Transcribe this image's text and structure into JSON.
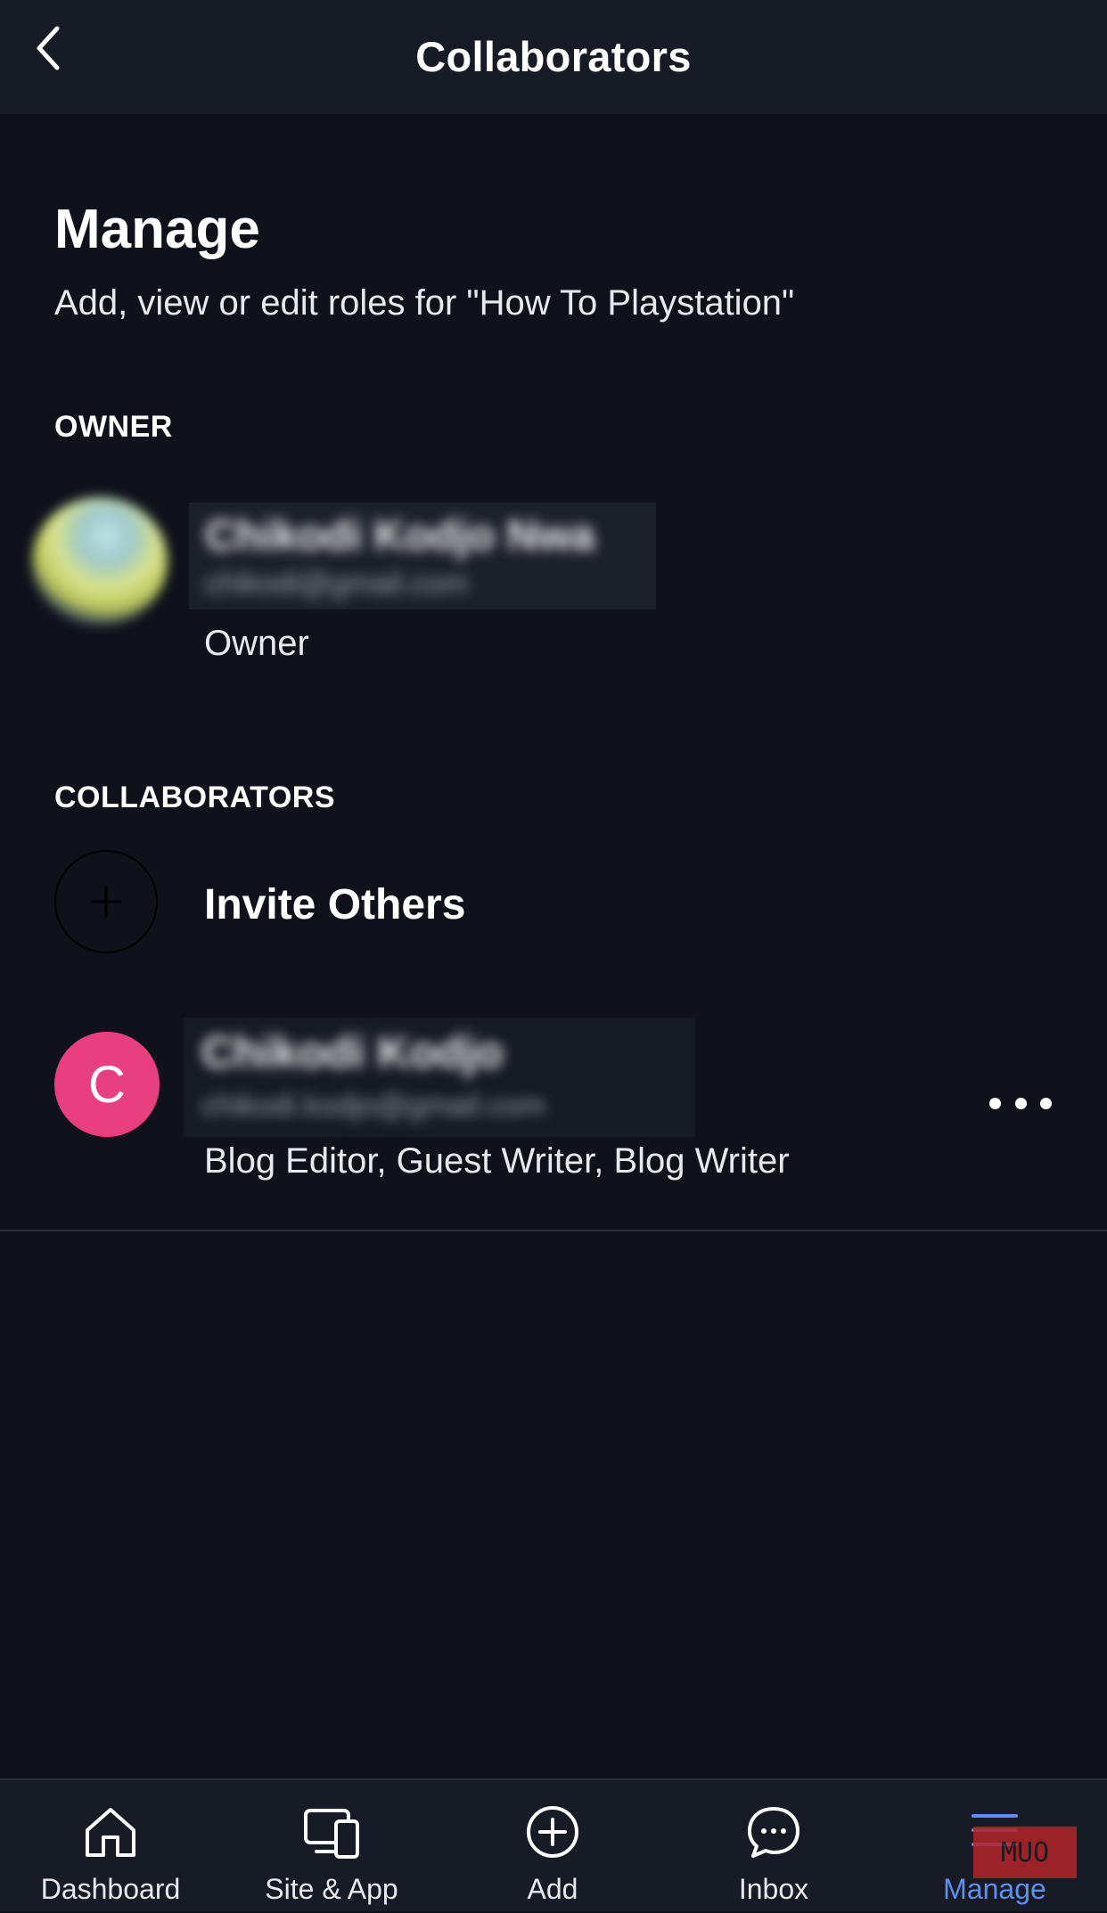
{
  "header": {
    "title": "Collaborators",
    "back_icon": "chevron-left-icon"
  },
  "manage": {
    "title": "Manage",
    "subtitle": "Add, view or edit roles for \"How To Playstation\""
  },
  "owner_section": {
    "label": "OWNER",
    "owner": {
      "name": "Chikodi Kodjo Nwa",
      "email": "chikodi@gmail.com",
      "role": "Owner"
    }
  },
  "collaborators_section": {
    "label": "COLLABORATORS",
    "invite_label": "Invite Others",
    "collaborators": [
      {
        "initial": "C",
        "name": "Chikodi Kodjo",
        "email": "chikodi.kodjo@gmail.com",
        "roles": "Blog Editor, Guest Writer, Blog Writer"
      }
    ]
  },
  "tabbar": {
    "tabs": [
      {
        "label": "Dashboard",
        "icon": "home-icon"
      },
      {
        "label": "Site & App",
        "icon": "devices-icon"
      },
      {
        "label": "Add",
        "icon": "plus-circle-icon"
      },
      {
        "label": "Inbox",
        "icon": "chat-bubble-icon"
      },
      {
        "label": "Manage",
        "icon": "menu-icon"
      }
    ],
    "active": "Manage"
  },
  "colors": {
    "background": "#0f121b",
    "bar_background": "#171b25",
    "accent": "#5f8ff0",
    "collaborator_avatar": "#e83f7e"
  },
  "watermark": "MUO"
}
